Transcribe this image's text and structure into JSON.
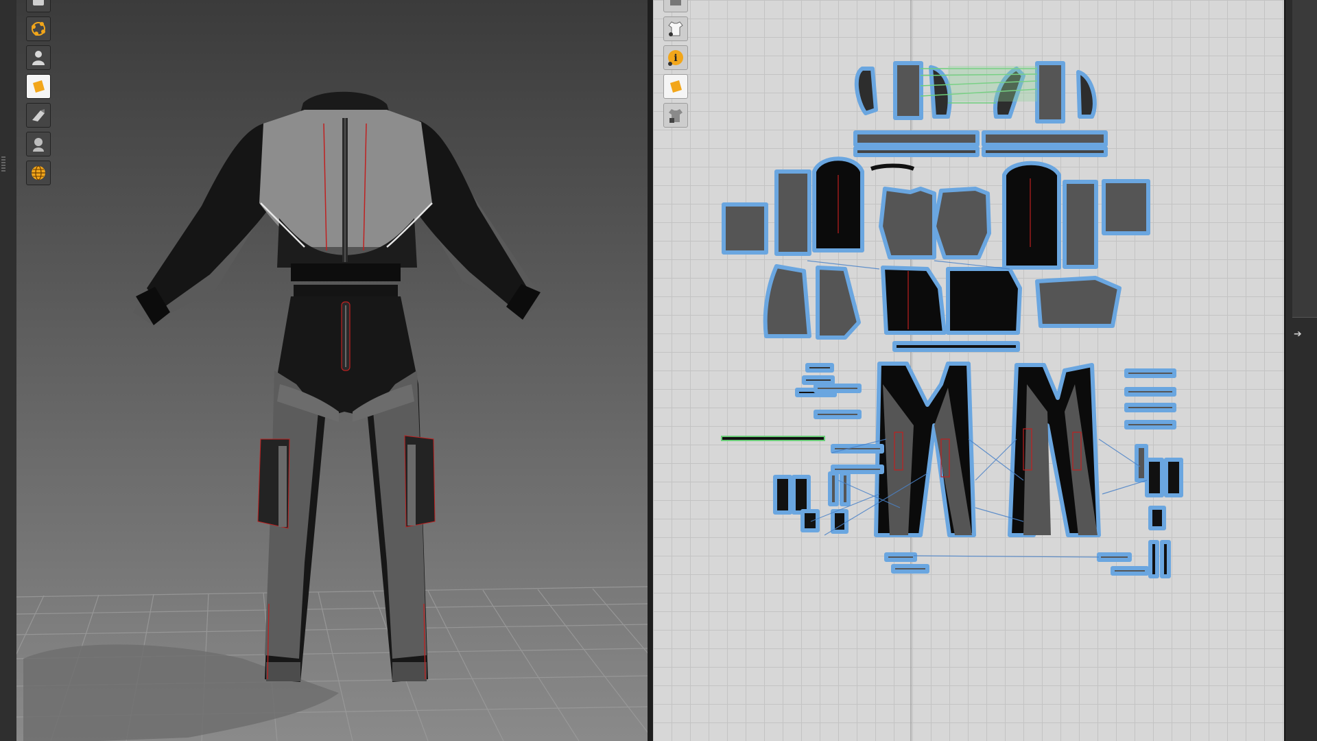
{
  "window": {
    "title": ""
  },
  "toolbar_3d": {
    "icons": [
      "avatar-icon",
      "point-cloud-icon",
      "avatar-display-icon",
      "texture-icon",
      "fabric-render-icon",
      "avatar-silhouette-icon",
      "globe-icon"
    ]
  },
  "toolbar_2d": {
    "icons": [
      "view-toggle-icon",
      "garment-visibility-icon",
      "info-icon",
      "texture-icon",
      "lock-garment-icon"
    ]
  },
  "colors": {
    "viewport_3d_top": "#3b3b3b",
    "viewport_3d_bottom": "#8a8a8a",
    "pattern_background": "#d7d7d7",
    "pattern_grid": "#c3c3c3",
    "pattern_outline": "#6aa6e0",
    "seam_line": "#4a82c8",
    "selected_seam": "#6ccf7a",
    "toolbar_accent": "#f2a61a",
    "garment_dark": "#111111",
    "garment_gray": "#5c5c5c",
    "piping_red": "#c02020"
  }
}
